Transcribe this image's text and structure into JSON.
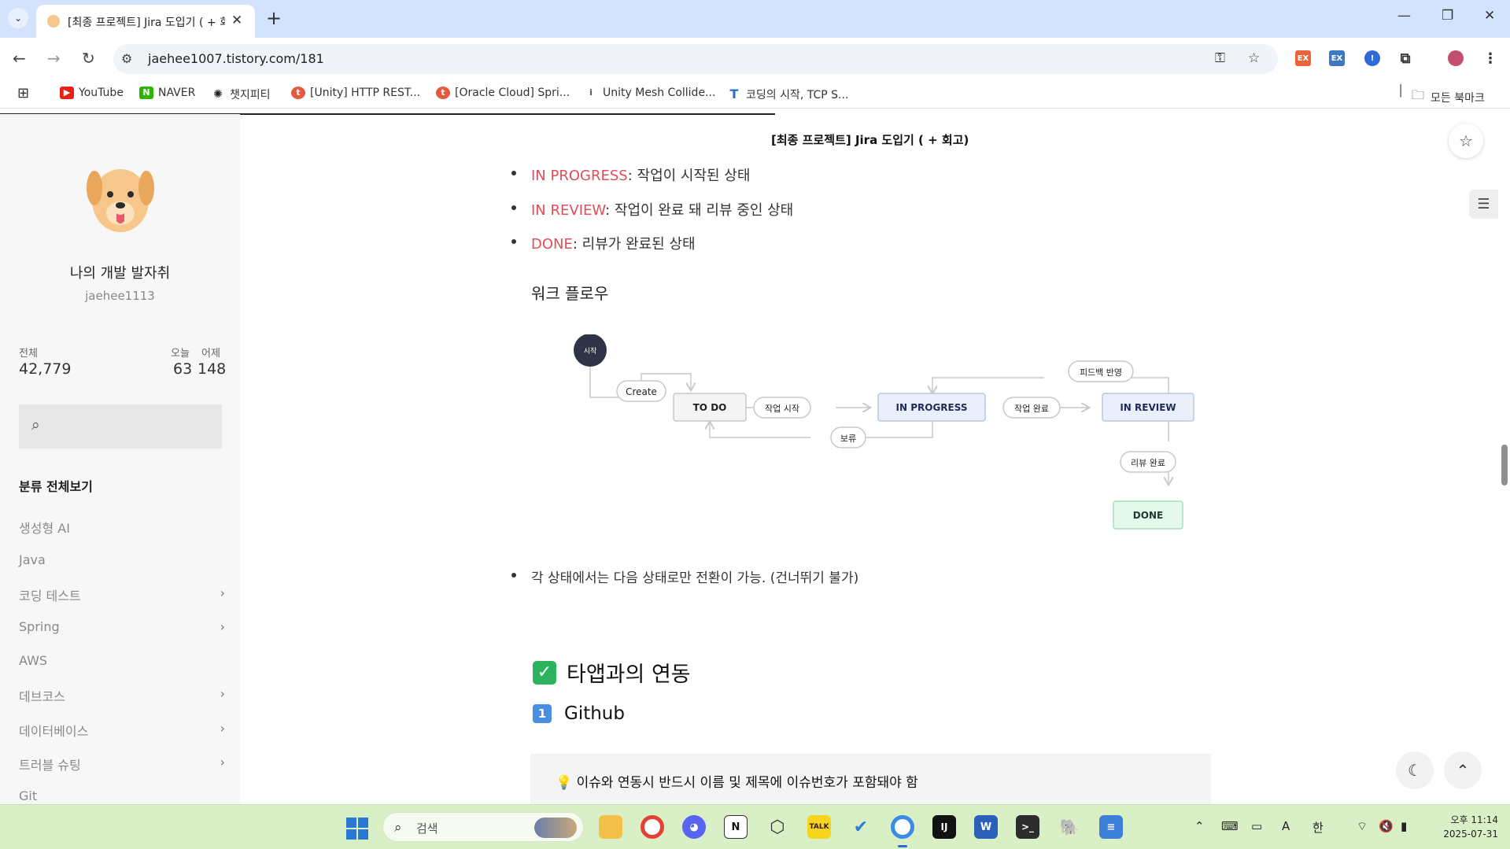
{
  "browser": {
    "tab_title": "[최종 프로젝트] Jira 도입기 ( + 회고)",
    "url": "jaehee1007.tistory.com/181",
    "bookmarks": [
      "YouTube",
      "NAVER",
      "챗지피티",
      "[Unity] HTTP REST...",
      "[Oracle Cloud] Spri...",
      "Unity Mesh Collide...",
      "코딩의 시작, TCP S..."
    ],
    "all_bookmarks": "모든 북마크",
    "ext_labels": [
      "EX",
      "EX"
    ]
  },
  "sidebar": {
    "blog_name": "나의 개발 발자취",
    "blog_id": "jaehee1113",
    "stats": {
      "total_label": "전체",
      "total_value": "42,779",
      "today_label": "오늘",
      "today_value": "63",
      "yesterday_label": "어제",
      "yesterday_value": "148"
    },
    "category_title": "분류 전체보기",
    "categories": [
      {
        "label": "생성형 AI",
        "has_children": false
      },
      {
        "label": "Java",
        "has_children": false
      },
      {
        "label": "코딩 테스트",
        "has_children": true
      },
      {
        "label": "Spring",
        "has_children": true
      },
      {
        "label": "AWS",
        "has_children": false
      },
      {
        "label": "데브코스",
        "has_children": true
      },
      {
        "label": "데이터베이스",
        "has_children": true
      },
      {
        "label": "트러블 슈팅",
        "has_children": true
      },
      {
        "label": "Git",
        "has_children": false
      }
    ]
  },
  "article": {
    "sticky_title": "[최종 프로젝트] Jira 도입기 ( + 회고)",
    "status_list": [
      {
        "term": "IN PROGRESS",
        "desc": ": 작업이 시작된 상태"
      },
      {
        "term": "IN REVIEW",
        "desc": ": 작업이 완료 돼 리뷰 중인 상태"
      },
      {
        "term": "DONE",
        "desc": ": 리뷰가 완료된 상태"
      }
    ],
    "workflow_title": "워크 플로우",
    "workflow": {
      "start": "시작",
      "create": "Create",
      "states": [
        "TO DO",
        "IN PROGRESS",
        "IN REVIEW",
        "DONE"
      ],
      "transitions": [
        "작업 시작",
        "작업 완료",
        "피드백 반영",
        "보류",
        "리뷰 완료"
      ]
    },
    "note": "각 상태에서는 다음 상태로만 전환이 가능. (건너뛰기 불가)",
    "h2": "타앱과의 연동",
    "h3": "Github",
    "callout": "이슈와 연동시 반드시 이름 및 제목에 이슈번호가 포함돼야 함"
  },
  "taskbar": {
    "search_placeholder": "검색",
    "ime": "한",
    "time": "오후 11:14",
    "date": "2025-07-31"
  },
  "colors": {
    "status_red": "#e04e5a",
    "tab_bg": "#d3e3fd",
    "taskbar_bg": "#d9efc6"
  }
}
